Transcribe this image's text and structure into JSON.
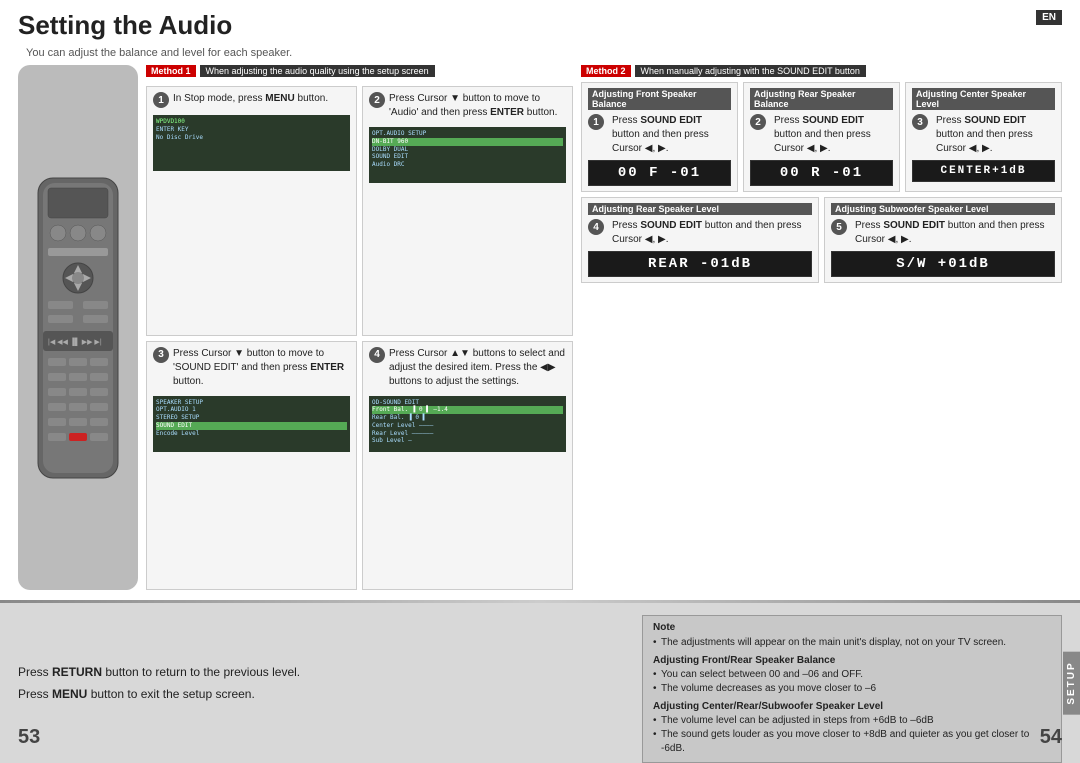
{
  "page": {
    "title": "Setting the Audio",
    "subtitle": "You can adjust the balance and level for each speaker.",
    "en_badge": "EN",
    "page_num_left": "53",
    "page_num_right": "54",
    "setup_tab": "SETUP"
  },
  "method1": {
    "badge": "Method 1",
    "title": "When adjusting the audio quality using the setup screen",
    "steps": [
      {
        "num": "1",
        "text": "In Stop mode, press MENU button.",
        "has_screen": true
      },
      {
        "num": "2",
        "text": "Press Cursor ▼ button to move to 'Audio' and then press ENTER button.",
        "has_screen": true
      },
      {
        "num": "3",
        "text": "Press Cursor ▼ button to move to 'SOUND EDIT' and then press ENTER button.",
        "has_screen": true
      },
      {
        "num": "4",
        "text": "Press Cursor ▲▼ buttons to select and adjust the desired item. Press the ◀▶ buttons to adjust the settings.",
        "has_screen": true
      }
    ]
  },
  "method2": {
    "badge": "Method 2",
    "title": "When manually adjusting with the SOUND EDIT button",
    "sections": [
      {
        "id": "front-balance",
        "title": "Adjusting Front Speaker Balance",
        "step_num": "1",
        "text": "Press SOUND EDIT button and then press Cursor ◀, ▶.",
        "display": "00 F -01"
      },
      {
        "id": "rear-balance",
        "title": "Adjusting Rear Speaker Balance",
        "step_num": "2",
        "text": "Press SOUND EDIT button and then press Cursor ◀, ▶.",
        "display": "00 R -01"
      },
      {
        "id": "center-level",
        "title": "Adjusting Center Speaker Level",
        "step_num": "3",
        "text": "Press SOUND EDIT button and then press Cursor ◀, ▶.",
        "display": "CENTER+1dB"
      },
      {
        "id": "rear-level",
        "title": "Adjusting Rear Speaker Level",
        "step_num": "4",
        "text": "Press SOUND EDIT button and then press Cursor ◀, ▶.",
        "display": "REAR -01dB"
      },
      {
        "id": "subwoofer-level",
        "title": "Adjusting Subwoofer Speaker Level",
        "step_num": "5",
        "text": "Press SOUND EDIT button and then press Cursor ◀, ▶.",
        "display": "S/W +01dB"
      }
    ]
  },
  "bottom": {
    "note1": "Press RETURN button to return to the previous level.",
    "note2": "Press MENU button to exit the setup screen.",
    "note_title": "Note",
    "note_items": [
      "The adjustments will appear on the main unit's display, not on your TV screen.",
      "Adjusting Front/Rear Speaker Balance",
      "You can select between 00 and –06 and OFF.",
      "The volume decreases as you move closer to –6",
      "Adjusting Center/Rear/Subwoofer Speaker Level",
      "The volume level can be adjusted in steps from +6dB to –6dB",
      "The sound gets louder as you move closer to +8dB and quieter as you get closer to -6dB."
    ]
  }
}
